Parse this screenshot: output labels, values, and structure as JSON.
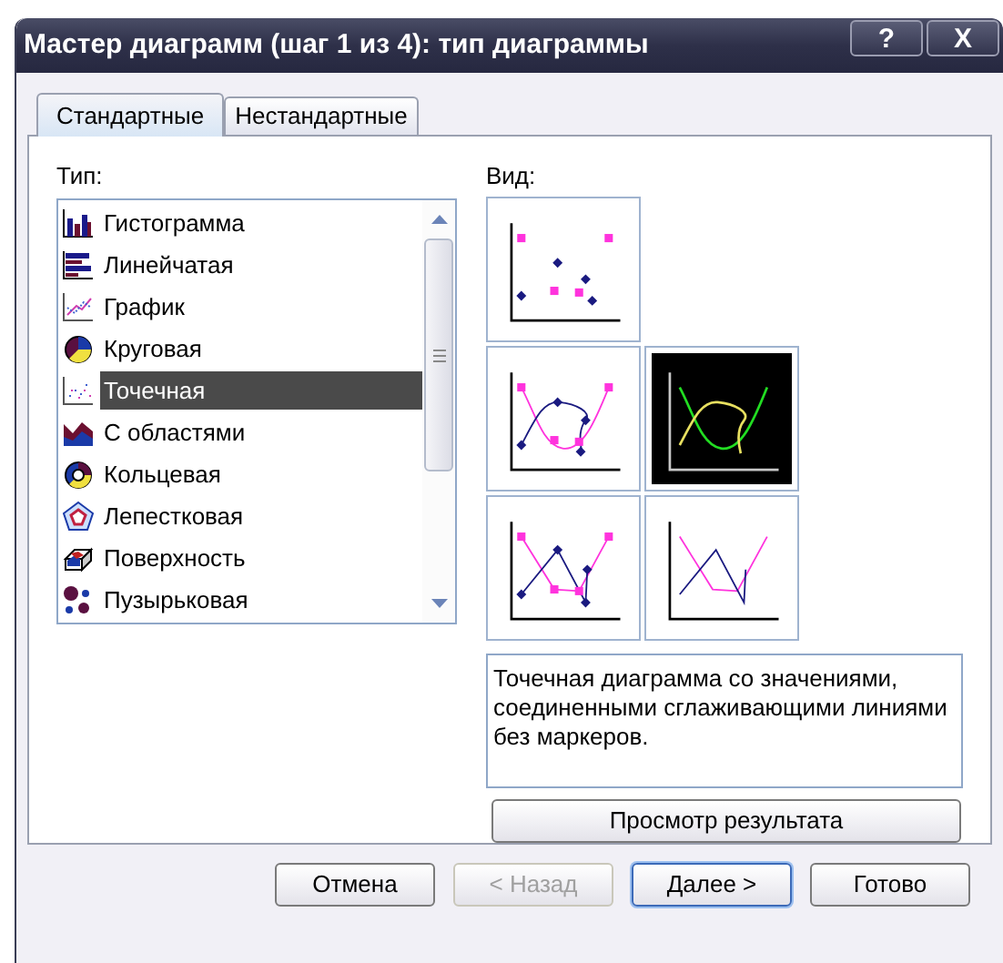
{
  "window": {
    "title": "Мастер диаграмм (шаг 1 из 4): тип диаграммы",
    "title_buttons": [
      "?",
      "X"
    ]
  },
  "tabs": [
    {
      "label": "Стандартные",
      "selected": true
    },
    {
      "label": "Нестандартные",
      "selected": false
    }
  ],
  "type_list": {
    "label": "Тип:",
    "items": [
      {
        "label": "Гистограмма",
        "kind": "column",
        "selected": false
      },
      {
        "label": "Линейчатая",
        "kind": "bar",
        "selected": false
      },
      {
        "label": "График",
        "kind": "line",
        "selected": false
      },
      {
        "label": "Круговая",
        "kind": "pie",
        "selected": false
      },
      {
        "label": "Точечная",
        "kind": "scatter",
        "selected": true
      },
      {
        "label": "С областями",
        "kind": "area",
        "selected": false
      },
      {
        "label": "Кольцевая",
        "kind": "doughnut",
        "selected": false
      },
      {
        "label": "Лепестковая",
        "kind": "radar",
        "selected": false
      },
      {
        "label": "Поверхность",
        "kind": "surface",
        "selected": false
      },
      {
        "label": "Пузырьковая",
        "kind": "bubble",
        "selected": false
      }
    ]
  },
  "subtypes": {
    "label": "Вид:",
    "items": [
      {
        "kind": "markers",
        "selected": false
      },
      {
        "kind": "smooth_markers",
        "selected": false
      },
      {
        "kind": "smooth",
        "selected": true
      },
      {
        "kind": "lines_markers",
        "selected": false
      },
      {
        "kind": "lines",
        "selected": false
      }
    ]
  },
  "description": "Точечная диаграмма со значениями, соединенными сглаживающими линиями без маркеров.",
  "preview_button": "Просмотр результата",
  "buttons": [
    {
      "label": "Отмена",
      "disabled": false,
      "default": false
    },
    {
      "label": "< Назад",
      "disabled": true,
      "default": false
    },
    {
      "label": "Далее >",
      "disabled": false,
      "default": true
    },
    {
      "label": "Готово",
      "disabled": false,
      "default": false
    }
  ]
}
